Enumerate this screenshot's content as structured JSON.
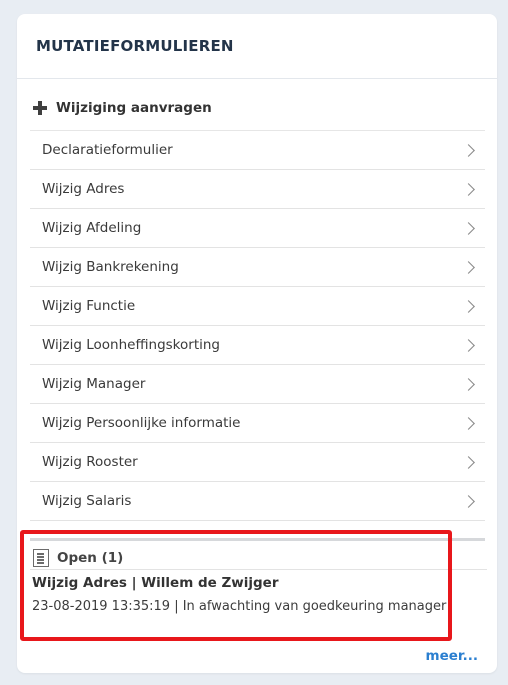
{
  "card": {
    "title": "MUTATIEFORMULIEREN"
  },
  "add_request": {
    "label": "Wijziging aanvragen",
    "icon": "plus-icon"
  },
  "menu": {
    "items": [
      {
        "label": "Declaratieformulier"
      },
      {
        "label": "Wijzig Adres"
      },
      {
        "label": "Wijzig Afdeling"
      },
      {
        "label": "Wijzig Bankrekening"
      },
      {
        "label": "Wijzig Functie"
      },
      {
        "label": "Wijzig Loonheffingskorting"
      },
      {
        "label": "Wijzig Manager"
      },
      {
        "label": "Wijzig Persoonlijke informatie"
      },
      {
        "label": "Wijzig Rooster"
      },
      {
        "label": "Wijzig Salaris"
      }
    ],
    "item_icon": "chevron-right-icon"
  },
  "open_section": {
    "label": "Open (1)",
    "icon": "document-icon",
    "entry_title": "Wijzig Adres | Willem de Zwijger",
    "entry_meta": "23-08-2019 13:35:19 | In afwachting van goedkeuring manager"
  },
  "more_link": {
    "label": "meer..."
  },
  "colors": {
    "page_background": "#e8edf3",
    "title": "#233449",
    "link": "#2b7fd0",
    "highlight_border": "#e8171b"
  }
}
